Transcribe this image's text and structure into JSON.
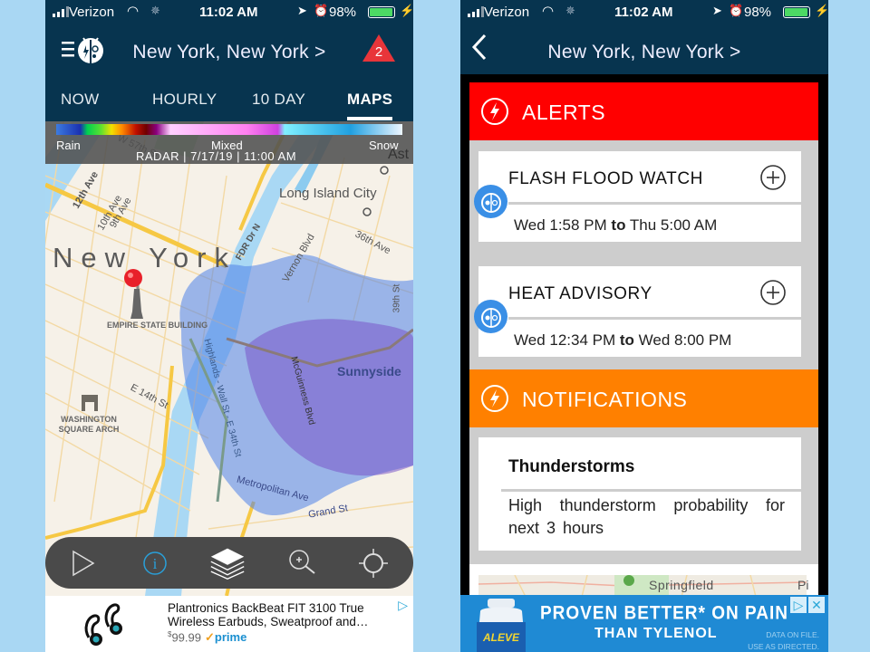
{
  "status_bar": {
    "carrier": "Verizon",
    "time": "11:02 AM",
    "battery": "98%",
    "battery_level": 0.98
  },
  "left_screen": {
    "nav": {
      "location_title": "New York, New York >",
      "alert_count": "2"
    },
    "tabs": [
      {
        "label": "NOW",
        "active": false
      },
      {
        "label": "HOURLY",
        "active": false
      },
      {
        "label": "10 DAY",
        "active": false
      },
      {
        "label": "MAPS",
        "active": true
      }
    ],
    "radar_legend": {
      "rain": "Rain",
      "mixed": "Mixed",
      "snow": "Snow",
      "timestamp": "RADAR | 7/17/19 | 11:00 AM"
    },
    "map_labels": {
      "city": "New York",
      "long_island_city": "Long Island City",
      "empire_state": "EMPIRE STATE BUILDING",
      "washington_square": "WASHINGTON SQUARE ARCH",
      "sunnyside": "Sunnyside",
      "ast": "Ast",
      "w57": "W 57th St",
      "ave12": "12th Ave",
      "ave10": "10th Ave",
      "ave9": "9th Ave",
      "fdr": "FDR Dr N",
      "vernon": "Vernon Blvd",
      "ave36": "36th Ave",
      "st39": "39th St",
      "e14": "E 14th St",
      "highlands": "Highlands - Wall St - E 34th St",
      "mcguinness": "McGuinness Blvd",
      "metropolitan": "Metropolitan Ave",
      "grand": "Grand St"
    },
    "map_toolbar": {
      "play": "play-icon",
      "info": "info-icon",
      "layers": "layers-icon",
      "zoom": "zoom-in-icon",
      "locate": "locate-icon"
    },
    "ad": {
      "title": "Plantronics BackBeat FIT 3100 True Wireless Earbuds, Sweatproof and…",
      "price_symbol": "$",
      "price": "99.99",
      "prime": "prime"
    }
  },
  "right_screen": {
    "nav": {
      "location_title": "New York, New York >"
    },
    "alerts_section": {
      "title": "ALERTS",
      "color": "#ff0000",
      "items": [
        {
          "name": "FLASH  FLOOD  WATCH",
          "start": "Wed 1:58 PM",
          "connector": "to",
          "end": "Thu 5:00 AM"
        },
        {
          "name": "HEAT  ADVISORY",
          "start": "Wed 12:34 PM",
          "connector": "to",
          "end": "Wed 8:00 PM"
        }
      ]
    },
    "notifications_section": {
      "title": "NOTIFICATIONS",
      "color": "#ff8000",
      "items": [
        {
          "title": "Thunderstorms",
          "description": "High thunderstorm probability for next 3 hours"
        }
      ]
    },
    "map_preview": {
      "label": "Springfield",
      "partial_label": "Pi"
    },
    "ad": {
      "brand": "ALEVE",
      "headline": "PROVEN BETTER* ON PAIN",
      "subline": "THAN TYLENOL",
      "fine_print_1": "DATA ON FILE.",
      "fine_print_2": "USE AS DIRECTED."
    }
  }
}
